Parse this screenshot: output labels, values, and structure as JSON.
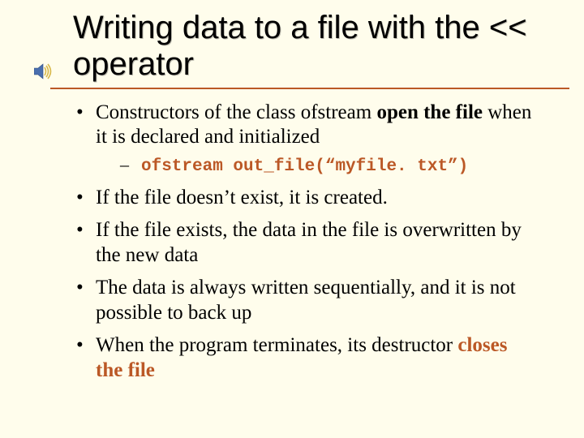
{
  "title": "Writing data to a file with the << operator",
  "bullets": {
    "b1a": "Constructors of the class ofstream ",
    "b1b": "open the file",
    "b1c": " when it is declared and initialized",
    "sub1": "ofstream out_file(“myfile. txt”)",
    "b2": "If the file doesn’t exist, it is created.",
    "b3": "If the file exists, the data in the file is overwritten by the new data",
    "b4": "The data is always written sequentially, and it is not possible to back up",
    "b5a": "When the program terminates, its destructor ",
    "b5b": "closes the file"
  },
  "icon_name": "sound-icon"
}
